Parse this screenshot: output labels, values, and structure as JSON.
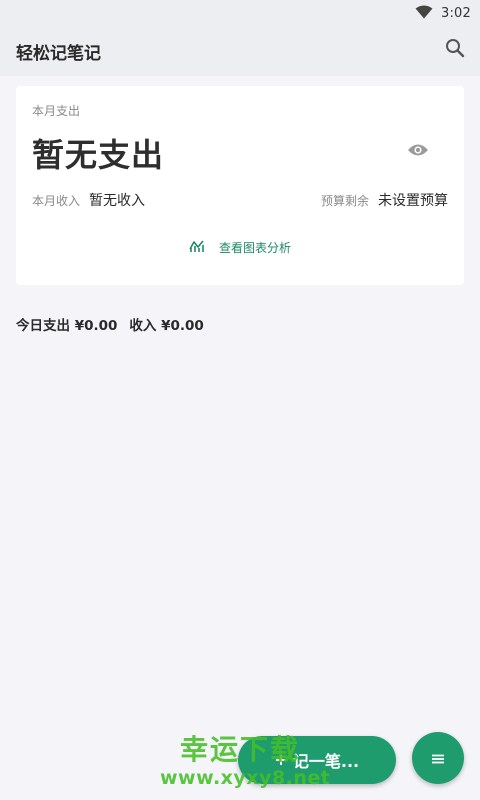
{
  "status_bar": {
    "time": "3:02",
    "wifi_icon": "wifi-icon"
  },
  "app_bar": {
    "title": "轻松记笔记",
    "search_icon": "search-icon"
  },
  "month_card": {
    "expense_label": "本月支出",
    "expense_value": "暂无支出",
    "visibility_icon": "eye-icon",
    "income_label": "本月收入",
    "income_value": "暂无收入",
    "budget_label": "预算剩余",
    "budget_value": "未设置预算",
    "chart_link_label": "查看图表分析",
    "chart_icon": "chart-icon"
  },
  "today": {
    "expense": "今日支出 ¥0.00",
    "income": "收入 ¥0.00"
  },
  "fab": {
    "record_label": "记一笔...",
    "record_icon": "plus-icon",
    "menu_icon": "menu-icon"
  },
  "watermark": {
    "line1": "幸运下载",
    "line2": "www.xyxy8.net"
  },
  "colors": {
    "accent": "#1e9c6e",
    "link": "#1e8a62",
    "background": "#f5f5f9",
    "bar": "#eceef1"
  }
}
